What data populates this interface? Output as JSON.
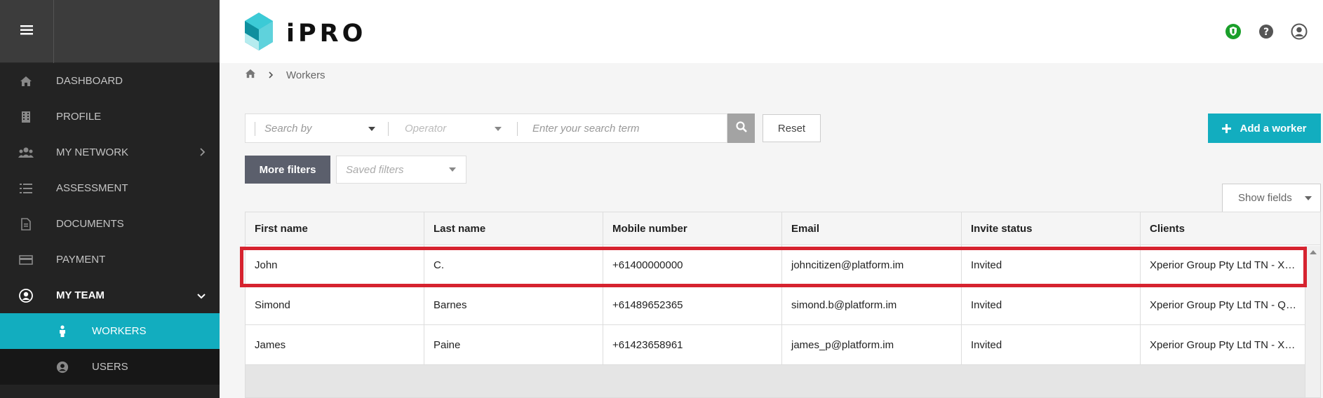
{
  "app": {
    "brand": "iPRO",
    "accent_color": "#12adbf"
  },
  "sidebar": {
    "menu_icon": "hamburger-icon",
    "items": [
      {
        "label": "DASHBOARD",
        "icon": "home-icon"
      },
      {
        "label": "PROFILE",
        "icon": "building-icon"
      },
      {
        "label": "MY NETWORK",
        "icon": "users-icon"
      },
      {
        "label": "ASSESSMENT",
        "icon": "list-icon"
      },
      {
        "label": "DOCUMENTS",
        "icon": "document-icon"
      },
      {
        "label": "PAYMENT",
        "icon": "credit-card-icon"
      },
      {
        "label": "MY TEAM",
        "icon": "user-circle-icon"
      }
    ],
    "sub_items": [
      {
        "label": "WORKERS",
        "icon": "person-icon"
      },
      {
        "label": "USERS",
        "icon": "user-circle-icon"
      }
    ]
  },
  "header": {
    "icons": [
      "shield-badge-icon",
      "help-icon",
      "account-icon"
    ]
  },
  "breadcrumb": {
    "current": "Workers"
  },
  "filters": {
    "search_by_placeholder": "Search by",
    "operator_placeholder": "Operator",
    "search_term_placeholder": "Enter your search term",
    "reset_label": "Reset",
    "add_worker_label": "Add a worker",
    "more_filters_label": "More filters",
    "saved_filters_placeholder": "Saved filters",
    "show_fields_label": "Show fields"
  },
  "table": {
    "columns": [
      "First name",
      "Last name",
      "Mobile number",
      "Email",
      "Invite status",
      "Clients"
    ],
    "rows": [
      [
        "John",
        "C.",
        "+61400000000",
        "johncitizen@platform.im",
        "Invited",
        "Xperior Group Pty Ltd TN - Xperior Group Pty Ltd"
      ],
      [
        "Simond",
        "Barnes",
        "+61489652365",
        "simond.b@platform.im",
        "Invited",
        "Xperior Group Pty Ltd TN - QLD Branch"
      ],
      [
        "James",
        "Paine",
        "+61423658961",
        "james_p@platform.im",
        "Invited",
        "Xperior Group Pty Ltd TN - Xperior Group Pty Ltd"
      ]
    ]
  }
}
